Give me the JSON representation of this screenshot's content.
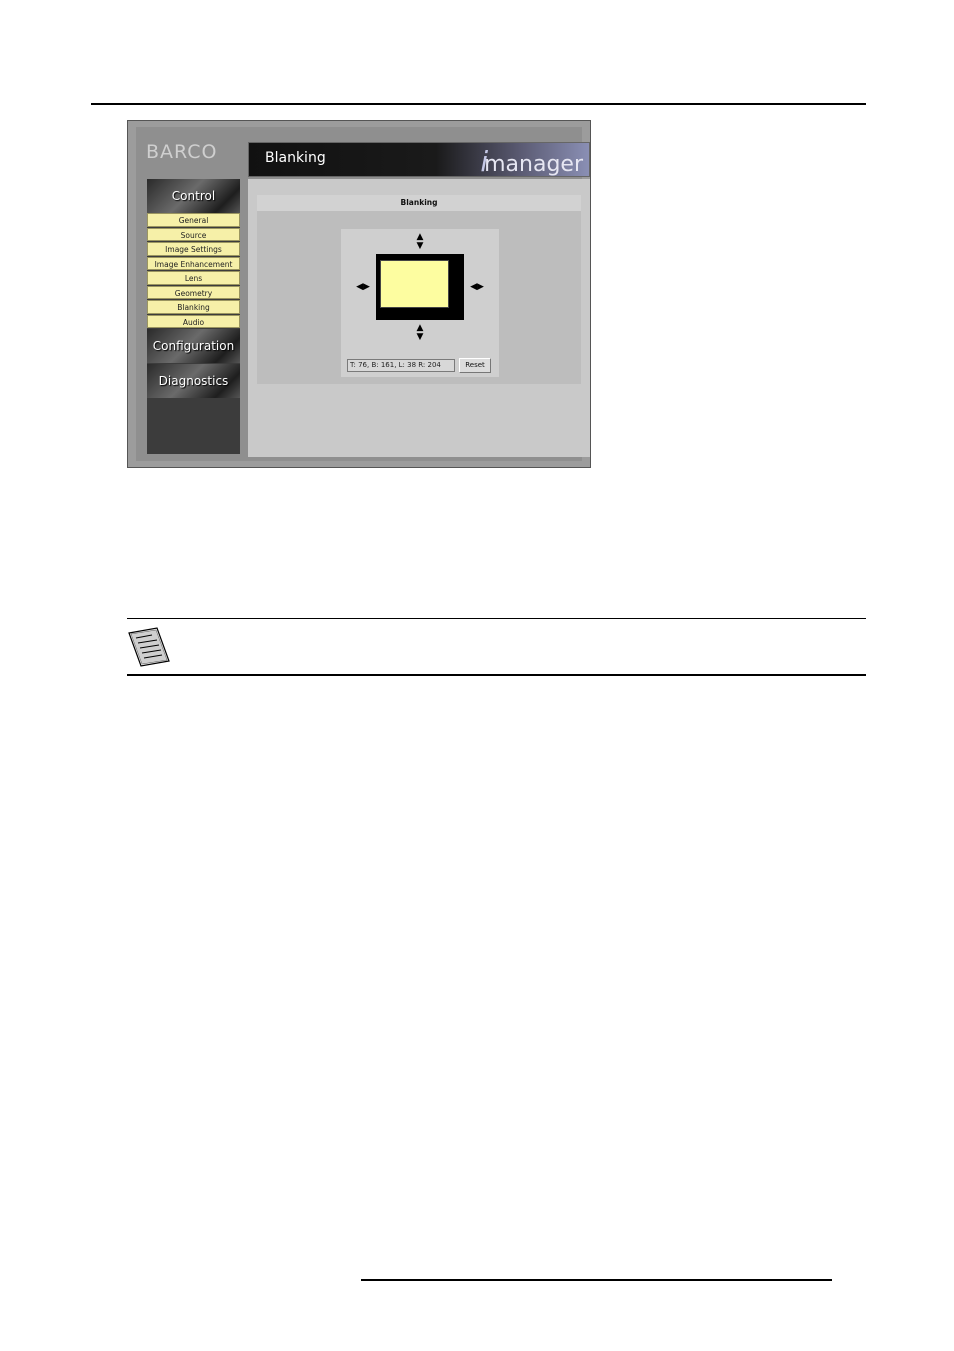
{
  "app": {
    "logo": "BARCO",
    "header_title": "Blanking",
    "brand_i": "i",
    "brand": "manager"
  },
  "sidebar": {
    "control": "Control",
    "items": [
      "General",
      "Source",
      "Image Settings",
      "Image Enhancement",
      "Lens",
      "Geometry",
      "Blanking",
      "Audio"
    ],
    "configuration": "Configuration",
    "diagnostics": "Diagnostics"
  },
  "panel": {
    "title": "Blanking",
    "readout": "T: 76, B: 161, L: 38 R: 204",
    "reset_label": "Reset"
  },
  "colors": {
    "blanking_area": "#fdfda0",
    "nav_item": "#f6f0a8"
  },
  "icons": {
    "arrow_up_down": "▲▼",
    "arrow_left_right": "◀▶",
    "note": "note-icon"
  }
}
